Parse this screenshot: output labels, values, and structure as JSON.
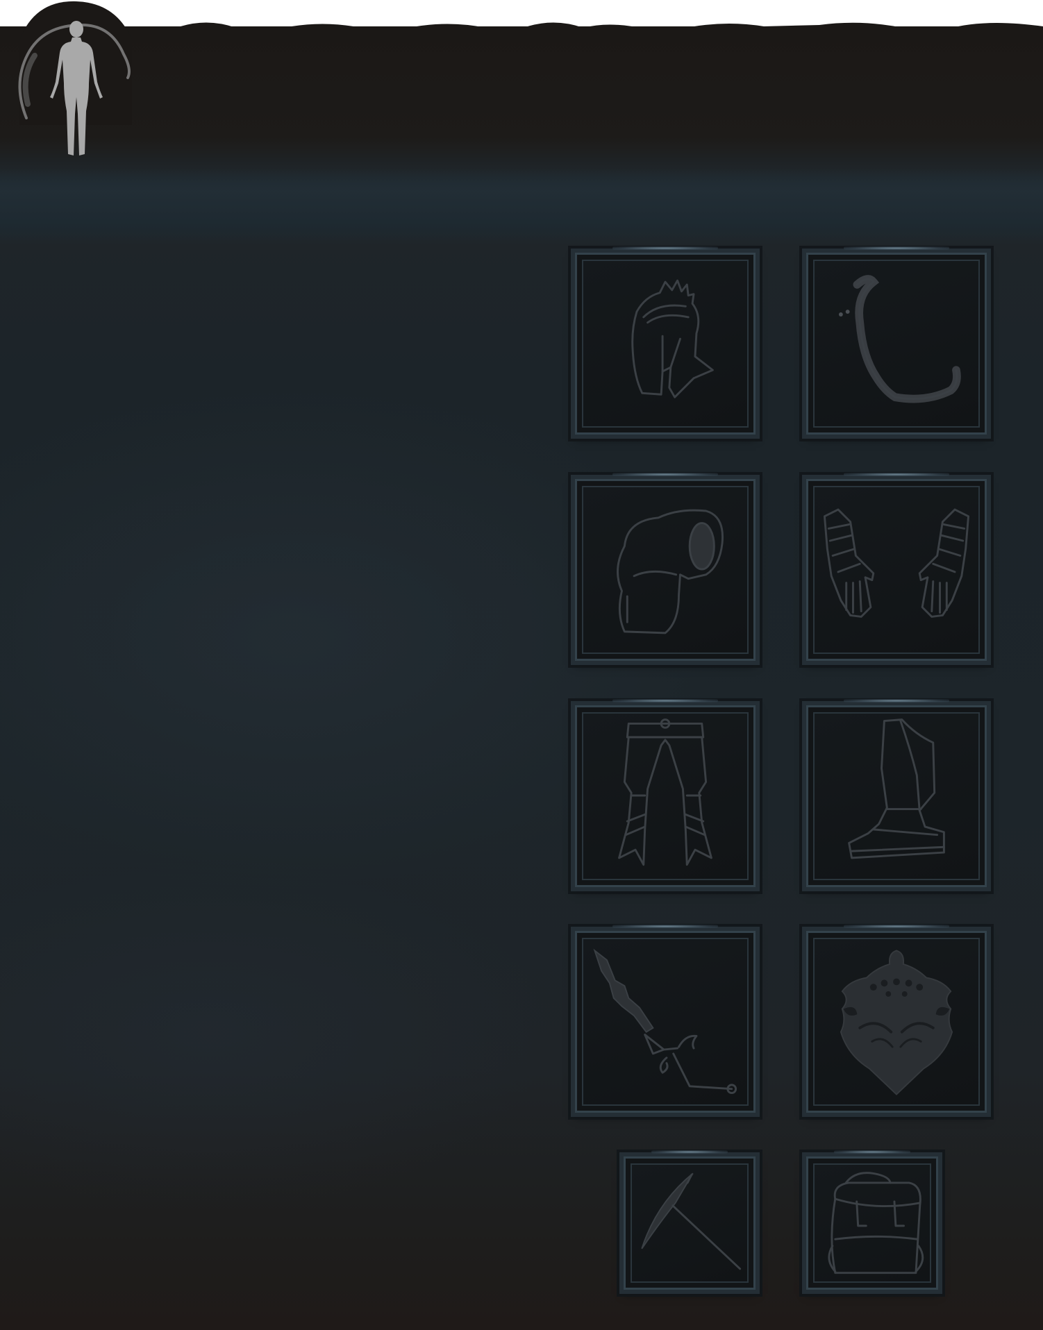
{
  "panel": {
    "emblem_icon": "human-silhouette-icon",
    "colors": {
      "background_top": "#1b1816",
      "background_mid": "#1d252a",
      "slot_border": "#33424b",
      "slot_fill": "#121517",
      "icon_stroke": "#3b4045",
      "emblem_figure": "#a9a9a9"
    }
  },
  "equipment_slots": [
    {
      "slot": "helmet",
      "icon": "helmet-icon"
    },
    {
      "slot": "cape",
      "icon": "cape-icon"
    },
    {
      "slot": "chest",
      "icon": "chest-armor-icon"
    },
    {
      "slot": "gloves",
      "icon": "gauntlets-icon"
    },
    {
      "slot": "legs",
      "icon": "leg-armor-icon"
    },
    {
      "slot": "boots",
      "icon": "boot-icon"
    },
    {
      "slot": "weapon",
      "icon": "sword-icon"
    },
    {
      "slot": "shield",
      "icon": "shield-icon"
    },
    {
      "slot": "tool",
      "icon": "pickaxe-icon"
    },
    {
      "slot": "bag",
      "icon": "backpack-icon"
    }
  ]
}
